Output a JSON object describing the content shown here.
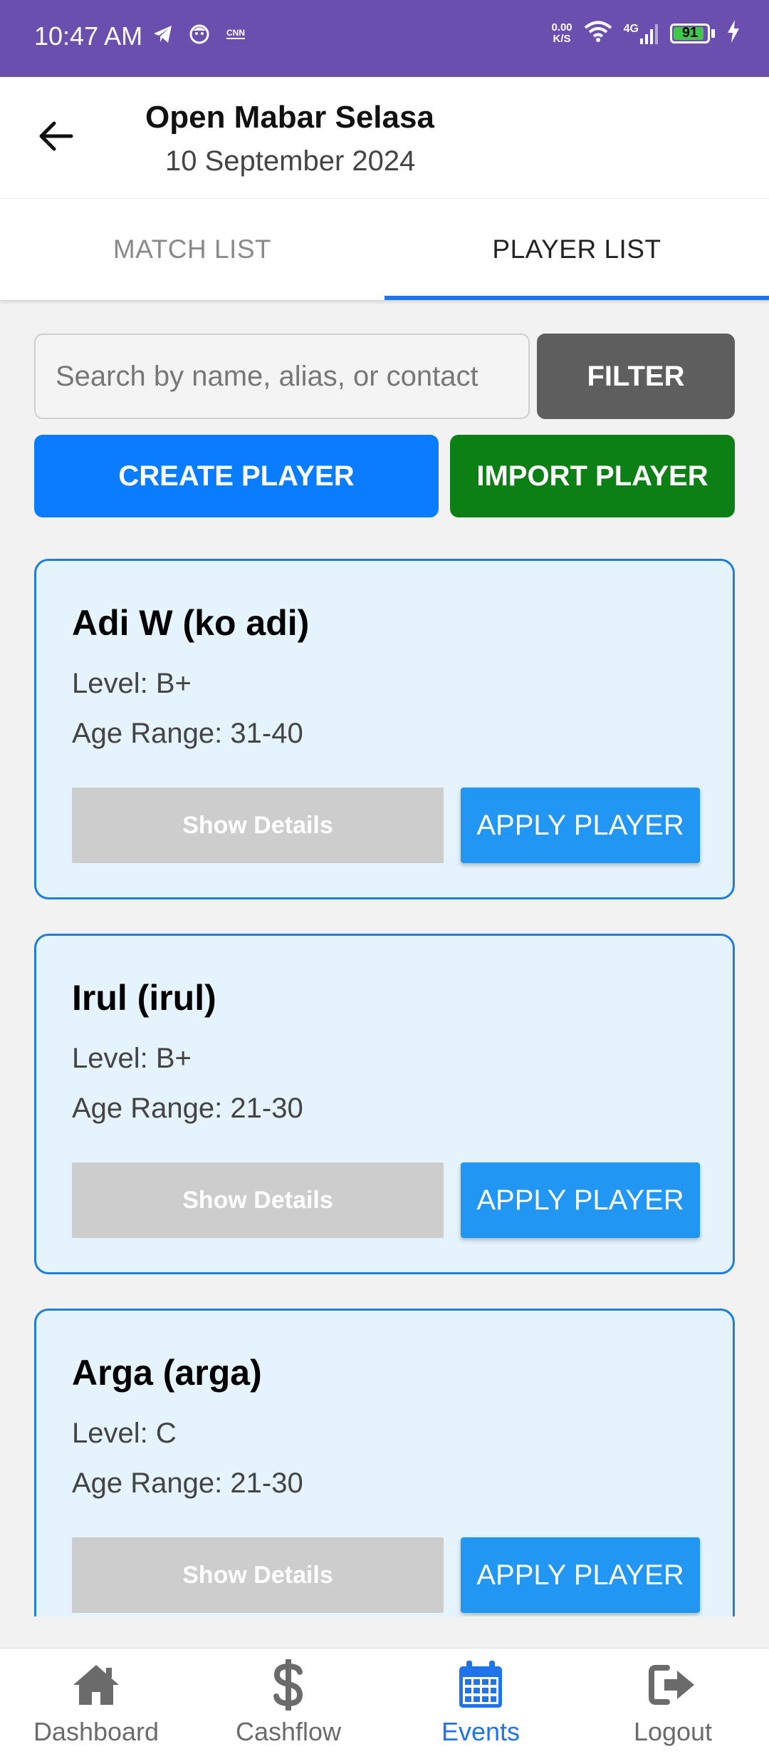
{
  "status_bar": {
    "time": "10:47 AM",
    "net_speed_value": "0.00",
    "net_speed_unit": "K/S",
    "network": "4G",
    "battery": "91",
    "battery_level": 0.91,
    "icons_left": [
      "telegram-icon",
      "face-icon",
      "cnn-icon"
    ],
    "icons_right": [
      "wifi-icon",
      "signal-icon",
      "battery-icon",
      "charging-icon"
    ]
  },
  "header": {
    "title": "Open Mabar Selasa",
    "subtitle": "10 September 2024",
    "back_icon": "arrow-left-icon"
  },
  "tabs": [
    {
      "label": "MATCH LIST",
      "active": false
    },
    {
      "label": "PLAYER LIST",
      "active": true
    }
  ],
  "toolbar": {
    "search_placeholder": "Search by name, alias, or contact",
    "search_value": "",
    "filter_label": "FILTER",
    "create_label": "CREATE PLAYER",
    "import_label": "IMPORT PLAYER"
  },
  "players": [
    {
      "name": "Adi W (ko adi)",
      "level": "Level: B+",
      "age": "Age Range: 31-40",
      "details_label": "Show Details",
      "apply_label": "APPLY PLAYER"
    },
    {
      "name": "Irul (irul)",
      "level": "Level: B+",
      "age": "Age Range: 21-30",
      "details_label": "Show Details",
      "apply_label": "APPLY PLAYER"
    },
    {
      "name": "Arga (arga)",
      "level": "Level: C",
      "age": "Age Range: 21-30",
      "details_label": "Show Details",
      "apply_label": "APPLY PLAYER"
    }
  ],
  "bottom_nav": [
    {
      "label": "Dashboard",
      "icon": "home-icon",
      "active": false
    },
    {
      "label": "Cashflow",
      "icon": "dollar-icon",
      "active": false
    },
    {
      "label": "Events",
      "icon": "calendar-icon",
      "active": true
    },
    {
      "label": "Logout",
      "icon": "logout-icon",
      "active": false
    }
  ],
  "colors": {
    "status_bar": "#6a4fae",
    "accent": "#1e74e8",
    "create": "#0a7cff",
    "import": "#0c8015",
    "filter": "#5e5e5e",
    "card_bg": "#e4f3fc",
    "card_border": "#1e7fd6",
    "apply": "#2196f3",
    "details": "#cdcdcd"
  }
}
